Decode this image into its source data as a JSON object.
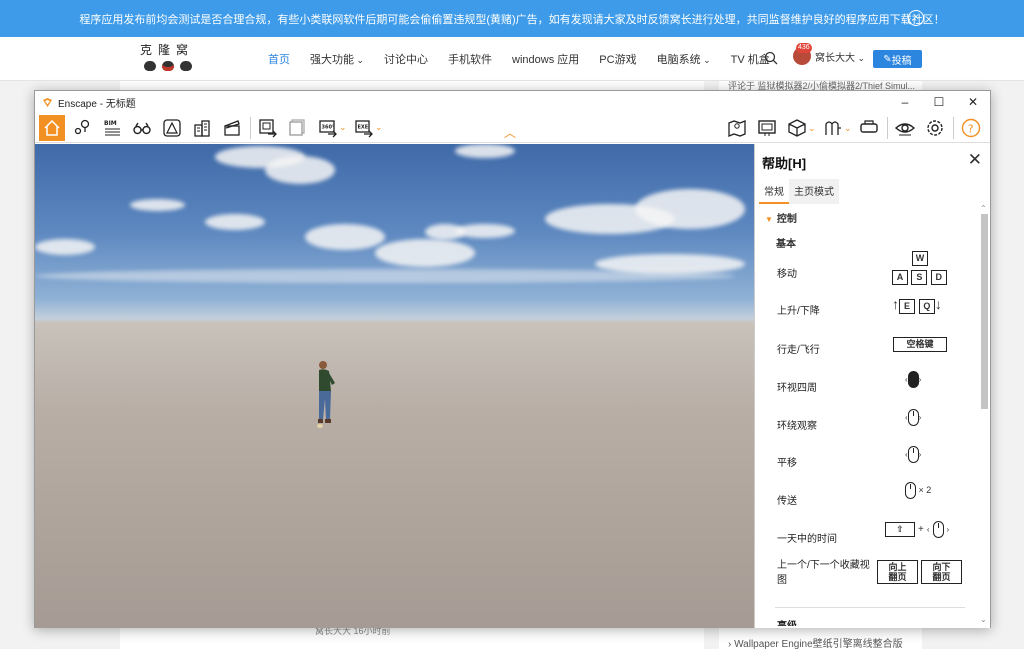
{
  "banner": {
    "text": "程序应用发布前均会测试是否合理合规，有些小类联网软件后期可能会偷偷置违规型(黄赌)广告，如有发现请大家及时反馈窝长进行处理，共同监督维护良好的程序应用下载社区！",
    "close": "×"
  },
  "site": {
    "logo": "克隆窝",
    "nav": [
      "首页",
      "强大功能",
      "讨论中心",
      "手机软件",
      "windows 应用",
      "PC游戏",
      "电脑系统",
      "TV 机盒"
    ],
    "user_badge": "436",
    "username": "窝长大大",
    "post_button": "投稿",
    "side_top_text": "评论于 监狱模拟器2/小偷模拟器2/Thief Simul...",
    "author_text": "窝长大大   16小时前",
    "side_bottom_text": "Wallpaper Engine壁纸引擎离线整合版"
  },
  "window": {
    "title": "Enscape - 无标题",
    "controls": [
      "–",
      "☐",
      "✕"
    ]
  },
  "toolbar": {
    "bim_label": "BIM",
    "label_360": "360°",
    "label_exe": "EXE"
  },
  "help": {
    "title": "帮助[H]",
    "tabs": [
      "常规",
      "主页模式"
    ],
    "section": "控制",
    "subsection": "基本",
    "rows": [
      {
        "label": "移动",
        "keys": [
          "W",
          "A",
          "S",
          "D"
        ]
      },
      {
        "label": "上升/下降",
        "keys": [
          "E",
          "Q"
        ]
      },
      {
        "label": "行走/飞行",
        "keys": [
          "空格键"
        ]
      },
      {
        "label": "环视四周"
      },
      {
        "label": "环绕观察"
      },
      {
        "label": "平移"
      },
      {
        "label": "传送",
        "suffix": "× 2"
      },
      {
        "label": "一天中的时间",
        "plus": "+"
      },
      {
        "label": "上一个/下一个收藏视图",
        "keys": [
          "向上\n翻页",
          "向下\n翻页"
        ]
      }
    ],
    "next_section": "高级"
  },
  "colors": {
    "banner": "#3d9be9",
    "accent": "#f29023",
    "link_active": "#2c86e0"
  }
}
